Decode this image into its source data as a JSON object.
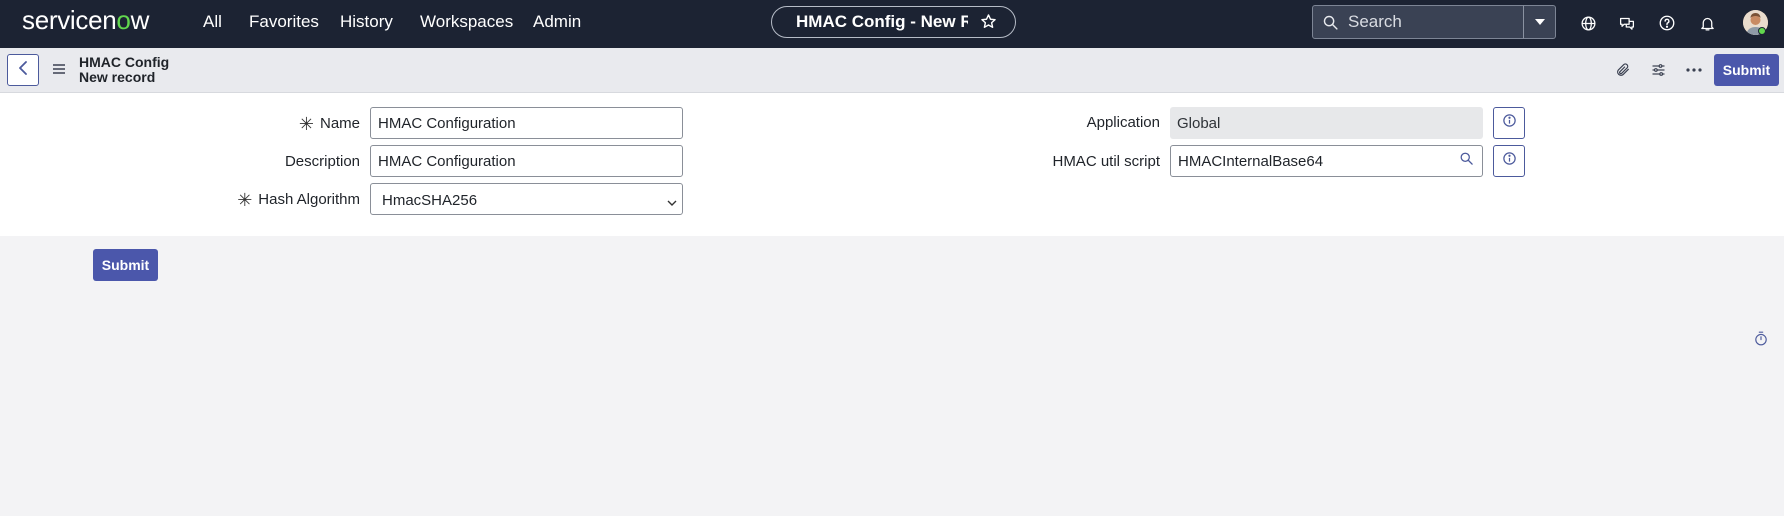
{
  "nav": {
    "logo_text_pre": "servicen",
    "logo_text_o": "o",
    "logo_text_post": "w",
    "items": [
      {
        "label": "All"
      },
      {
        "label": "Favorites"
      },
      {
        "label": "History"
      },
      {
        "label": "Workspaces"
      },
      {
        "label": "Admin"
      }
    ],
    "context_pill": {
      "title": "HMAC Config - New R…",
      "icon": "star-icon"
    },
    "search": {
      "placeholder": "Search"
    },
    "icons": [
      "globe-icon",
      "chat-icon",
      "help-icon",
      "bell-icon"
    ]
  },
  "record_header": {
    "title_line1": "HMAC Config",
    "title_line2": "New record",
    "submit_label": "Submit",
    "icons": [
      "back-icon",
      "menu-icon",
      "paperclip-icon",
      "sliders-icon",
      "more-icon"
    ]
  },
  "form": {
    "name": {
      "label": "Name",
      "value": "HMAC Configuration",
      "required": true
    },
    "description": {
      "label": "Description",
      "value": "HMAC Configuration"
    },
    "hash_algorithm": {
      "label": "Hash Algorithm",
      "value": "HmacSHA256",
      "required": true
    },
    "application": {
      "label": "Application",
      "value": "Global"
    },
    "hmac_util_script": {
      "label": "HMAC util script",
      "value": "HMACInternalBase64"
    },
    "submit_label": "Submit"
  },
  "colors": {
    "nav_bg": "#1c2333",
    "brand_green": "#62d84e",
    "primary_button": "#4b57ab",
    "header_bg": "#e9eaee",
    "page_bg": "#f3f3f5"
  }
}
